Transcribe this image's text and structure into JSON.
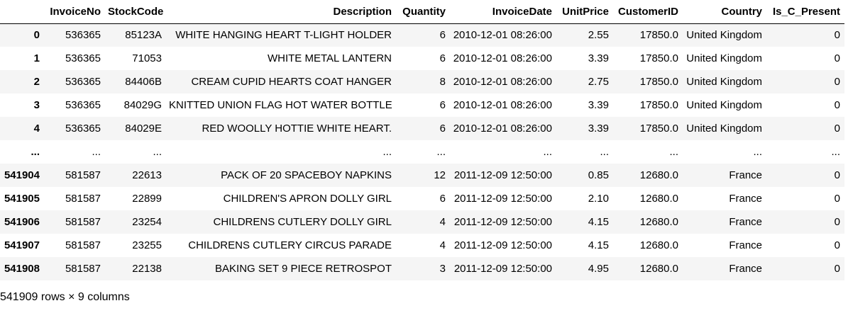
{
  "table": {
    "columns": [
      "",
      "InvoiceNo",
      "StockCode",
      "Description",
      "Quantity",
      "InvoiceDate",
      "UnitPrice",
      "CustomerID",
      "Country",
      "Is_C_Present"
    ],
    "rows": [
      [
        "0",
        "536365",
        "85123A",
        "WHITE HANGING HEART T-LIGHT HOLDER",
        "6",
        "2010-12-01 08:26:00",
        "2.55",
        "17850.0",
        "United Kingdom",
        "0"
      ],
      [
        "1",
        "536365",
        "71053",
        "WHITE METAL LANTERN",
        "6",
        "2010-12-01 08:26:00",
        "3.39",
        "17850.0",
        "United Kingdom",
        "0"
      ],
      [
        "2",
        "536365",
        "84406B",
        "CREAM CUPID HEARTS COAT HANGER",
        "8",
        "2010-12-01 08:26:00",
        "2.75",
        "17850.0",
        "United Kingdom",
        "0"
      ],
      [
        "3",
        "536365",
        "84029G",
        "KNITTED UNION FLAG HOT WATER BOTTLE",
        "6",
        "2010-12-01 08:26:00",
        "3.39",
        "17850.0",
        "United Kingdom",
        "0"
      ],
      [
        "4",
        "536365",
        "84029E",
        "RED WOOLLY HOTTIE WHITE HEART.",
        "6",
        "2010-12-01 08:26:00",
        "3.39",
        "17850.0",
        "United Kingdom",
        "0"
      ],
      [
        "...",
        "...",
        "...",
        "...",
        "...",
        "...",
        "...",
        "...",
        "...",
        "..."
      ],
      [
        "541904",
        "581587",
        "22613",
        "PACK OF 20 SPACEBOY NAPKINS",
        "12",
        "2011-12-09 12:50:00",
        "0.85",
        "12680.0",
        "France",
        "0"
      ],
      [
        "541905",
        "581587",
        "22899",
        "CHILDREN'S APRON DOLLY GIRL",
        "6",
        "2011-12-09 12:50:00",
        "2.10",
        "12680.0",
        "France",
        "0"
      ],
      [
        "541906",
        "581587",
        "23254",
        "CHILDRENS CUTLERY DOLLY GIRL",
        "4",
        "2011-12-09 12:50:00",
        "4.15",
        "12680.0",
        "France",
        "0"
      ],
      [
        "541907",
        "581587",
        "23255",
        "CHILDRENS CUTLERY CIRCUS PARADE",
        "4",
        "2011-12-09 12:50:00",
        "4.15",
        "12680.0",
        "France",
        "0"
      ],
      [
        "541908",
        "581587",
        "22138",
        "BAKING SET 9 PIECE RETROSPOT",
        "3",
        "2011-12-09 12:50:00",
        "4.95",
        "12680.0",
        "France",
        "0"
      ]
    ]
  },
  "shape_label": "541909 rows × 9 columns"
}
